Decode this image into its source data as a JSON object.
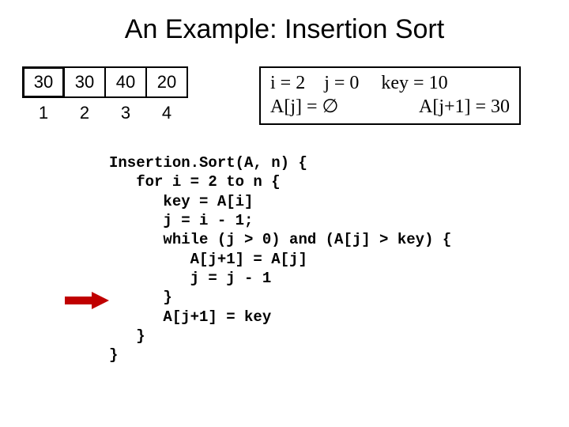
{
  "title": "An Example: Insertion Sort",
  "array": {
    "values": [
      "30",
      "30",
      "40",
      "20"
    ],
    "indices": [
      "1",
      "2",
      "3",
      "4"
    ],
    "highlight_index": 0
  },
  "state": {
    "line1_left": "i = 2    j = 0",
    "line1_right": "key = 10",
    "line2_left": "A[j] = ∅",
    "line2_right": "A[j+1] = 30"
  },
  "code": {
    "l0": "Insertion.Sort(A, n) {",
    "l1": "   for i = 2 to n {",
    "l2": "      key = A[i]",
    "l3": "      j = i - 1;",
    "l4": "      while (j > 0) and (A[j] > key) {",
    "l5": "         A[j+1] = A[j]",
    "l6": "         j = j - 1",
    "l7": "      }",
    "l8": "      A[j+1] = key",
    "l9": "   }",
    "l10": "}"
  }
}
